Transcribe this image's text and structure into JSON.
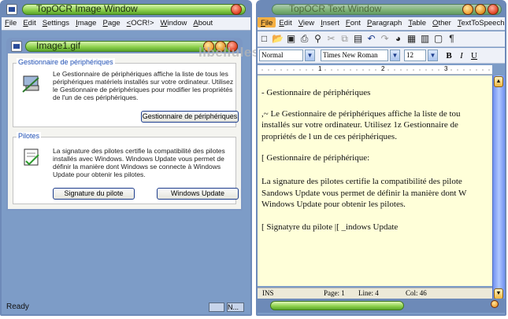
{
  "left_window": {
    "title": "TopOCR Image Window",
    "menu": [
      "File",
      "Edit",
      "Settings",
      "Image",
      "Page",
      "<OCR!>",
      "Window",
      "About"
    ],
    "status": "Ready",
    "status_right": "N..."
  },
  "image_window": {
    "title": "Image1.gif",
    "group1": {
      "label": "Gestionnaire de périphériques",
      "text": "Le Gestionnaire de périphériques affiche la liste de tous les périphériques matériels installés sur votre ordinateur. Utilisez le Gestionnaire de périphériques pour modifier les propriétés de l'un de ces périphériques.",
      "button": "Gestionnaire de périphériques"
    },
    "group2": {
      "label": "Pilotes",
      "text": "La signature des pilotes certifie la compatibilité des pilotes installés avec Windows. Windows Update vous permet de définir la manière dont Windows se connecte à Windows Update pour obtenir les pilotes.",
      "button1": "Signature du pilote",
      "button2": "Windows Update"
    }
  },
  "watermark": "libellules.ch",
  "right_window": {
    "title": "TopOCR Text Window",
    "menu": [
      "File",
      "Edit",
      "View",
      "Insert",
      "Font",
      "Paragraph",
      "Table",
      "Other",
      "TextToSpeech"
    ],
    "style_value": "Normal",
    "font_value": "Times New Roman",
    "size_value": "12",
    "ruler_marks": [
      "1",
      "2",
      "3"
    ],
    "document_lines": [
      "- Gestionnaire de périphériques",
      "",
      ",~ Le Gestionnaire de périphériques affiche la liste de tou",
      "installés sur votre ordinateur. Utilisez 1z Gestionnaire de",
      "propriétés de l un de ces périphériques.",
      "",
      "[ Gestionnaire de périphérique:",
      "",
      "La signature des pilotes certifie la compatibilité des pilote",
      "Sandows Update vous permet de définir la manière dont W",
      "Windows Update pour obtenir les pilotes.",
      "",
      "[  Signatyre du pilote  |[  _indows Update"
    ],
    "status": {
      "mode": "INS",
      "page": "Page: 1",
      "line": "Line: 4",
      "col": "Col: 46"
    }
  }
}
